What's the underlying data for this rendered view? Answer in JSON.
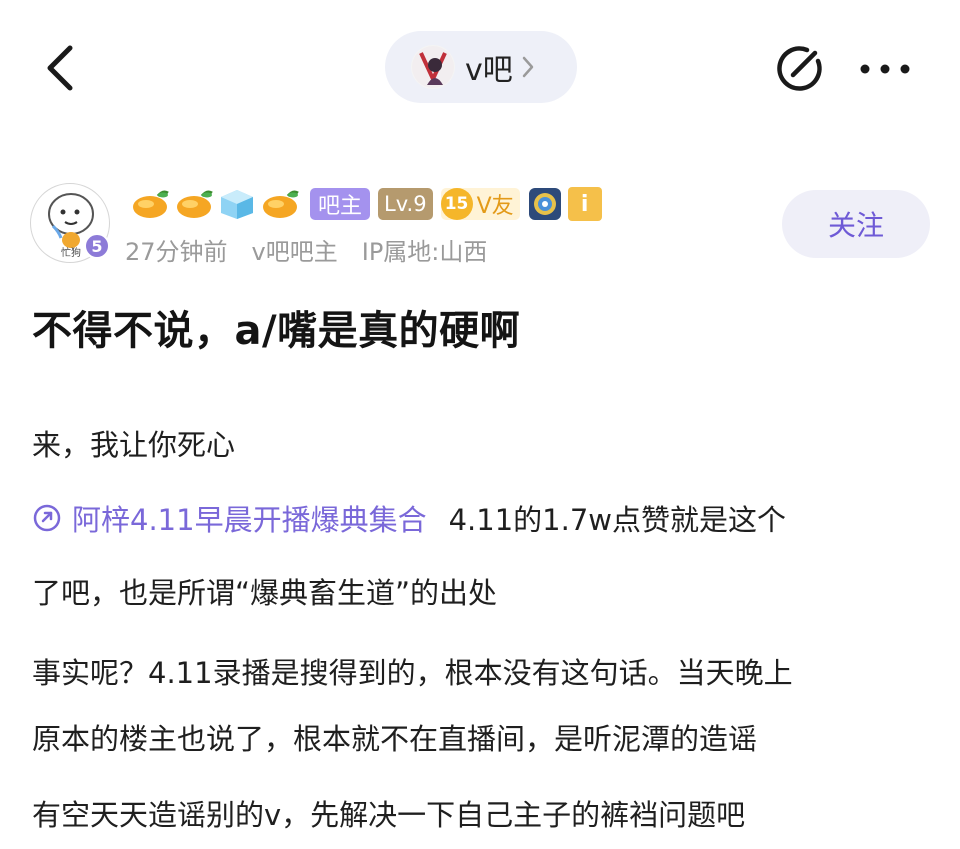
{
  "header": {
    "forum_name": "v吧"
  },
  "author": {
    "avatar_caption": "忙狗",
    "level_dot": "5",
    "tags": {
      "owner": "吧主",
      "level": "Lv.9",
      "vyou_num": "15",
      "vyou_label": "V友"
    },
    "time": "27分钟前",
    "role": "v吧吧主",
    "ip": "IP属地:山西"
  },
  "follow_label": "关注",
  "post": {
    "title": "不得不说，a/嘴是真的硬啊",
    "line1": "来，我让你死心",
    "link_text": "阿梓4.11早晨开播爆典集合",
    "line2_rest": "4.11的1.7w点赞就是这个",
    "line3": "了吧，也是所谓“爆典畜生道”的出处",
    "line4": "事实呢？4.11录播是搜得到的，根本没有这句话。当天晚上",
    "line5": "原本的楼主也说了，根本就不在直播间，是听泥潭的造谣",
    "line6": "有空天天造谣别的v，先解决一下自己主子的裤裆问题吧"
  },
  "colors": {
    "accent": "#7a68d9",
    "owner_tag": "#a492ee",
    "level_tag": "#b59a6e",
    "vyou": "#f5b62a",
    "meta_text": "#9a9a9a"
  },
  "icons": [
    "back-arrow-icon",
    "forum-avatar-icon",
    "chevron-right-icon",
    "edit-icon",
    "more-icon",
    "mango-icon",
    "ice-cube-icon",
    "medal-icon",
    "info-icon",
    "link-icon"
  ]
}
